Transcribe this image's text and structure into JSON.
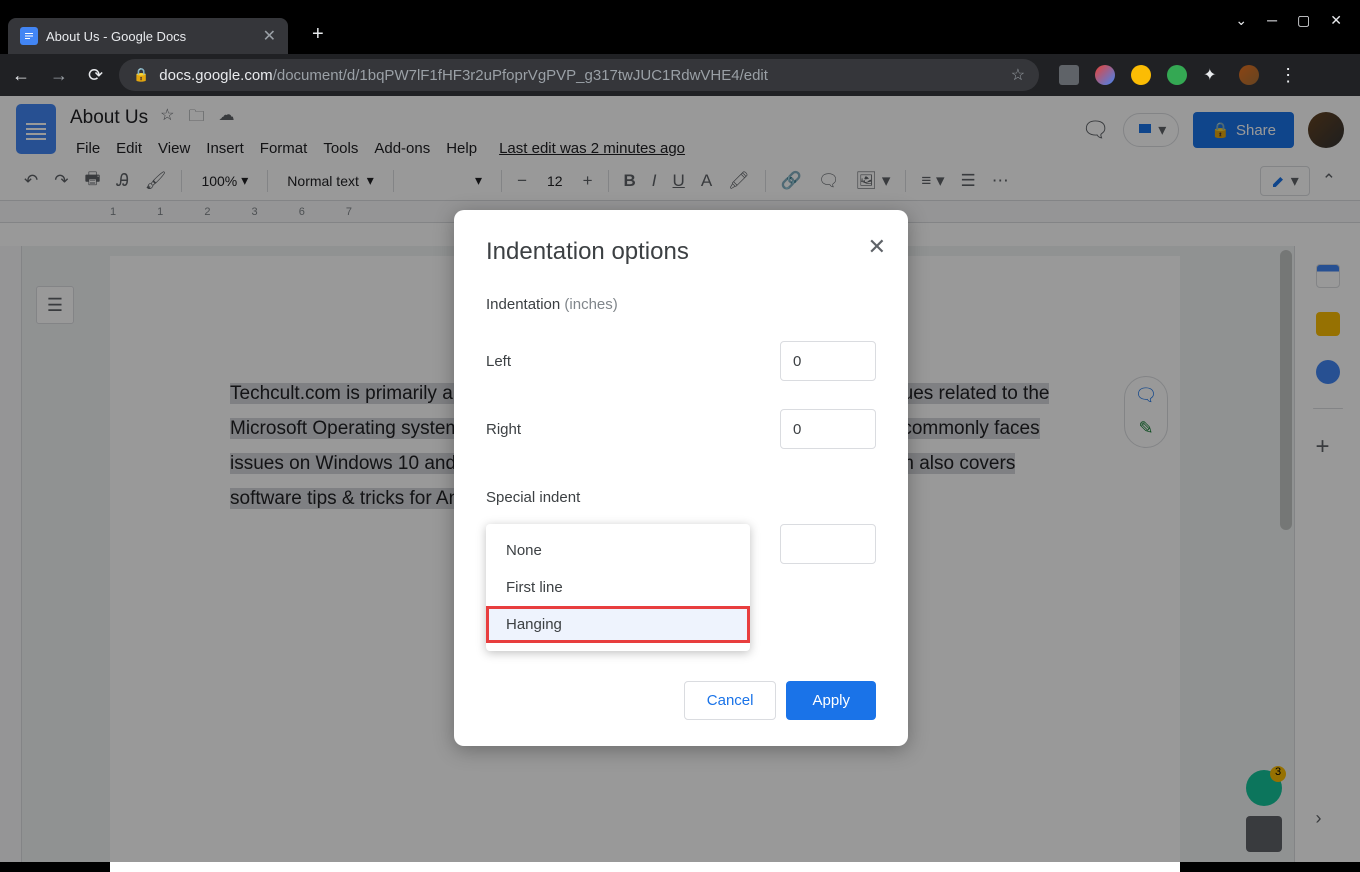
{
  "browser": {
    "tab_title": "About Us - Google Docs",
    "url_domain": "docs.google.com",
    "url_path": "/document/d/1bqPW7lF1fHF3r2uPfoprVgPVP_g317twJUC1RdwVHE4/edit"
  },
  "docs": {
    "title": "About Us",
    "menu": [
      "File",
      "Edit",
      "View",
      "Insert",
      "Format",
      "Tools",
      "Add-ons",
      "Help"
    ],
    "last_edit": "Last edit was 2 minutes ago",
    "share_label": "Share",
    "zoom": "100%",
    "style": "Normal text",
    "font_size": "12",
    "ruler": "1                       1              2              3                                                                          6              7",
    "body": "Techcult.com is primarily a Windows website which helps uses with technical issues related to the Microsoft Operating system. At Techcult.com we focus on providing the fixes for commonly faces issues on Windows 10 and other Microsoft products. Apart from this Techcult.com also covers software tips & tricks for Android, iOS, Eclipse, Google Chrome, VLC, etc"
  },
  "modal": {
    "title": "Indentation options",
    "section": "Indentation",
    "unit": "(inches)",
    "left_label": "Left",
    "left_value": "0",
    "right_label": "Right",
    "right_value": "0",
    "special_label": "Special indent",
    "options": [
      "None",
      "First line",
      "Hanging"
    ],
    "cancel": "Cancel",
    "apply": "Apply"
  }
}
